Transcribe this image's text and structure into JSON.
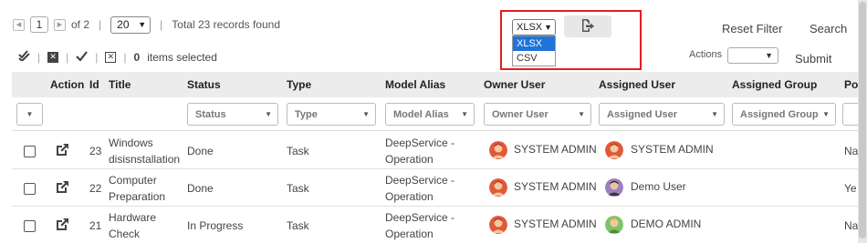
{
  "pager": {
    "current_page": "1",
    "of_label": "of 2",
    "page_size": "20",
    "total_label": "Total 23 records found"
  },
  "selection": {
    "count": "0",
    "label": "items selected"
  },
  "export": {
    "selected_format": "XLSX",
    "options": [
      "XLSX",
      "CSV"
    ]
  },
  "toolbar": {
    "reset_filter": "Reset Filter",
    "search": "Search",
    "actions_label": "Actions",
    "submit": "Submit"
  },
  "table": {
    "columns": [
      "Action",
      "Id",
      "Title",
      "Status",
      "Type",
      "Model Alias",
      "Owner User",
      "Assigned User",
      "Assigned Group",
      "Po"
    ],
    "filters": [
      "Status",
      "Type",
      "Model Alias",
      "Owner User",
      "Assigned User",
      "Assigned Group"
    ],
    "rows": [
      {
        "id": "23",
        "title_1": "Windows",
        "title_2": "disisnstallation",
        "status": "Done",
        "type": "Task",
        "model_1": "DeepService -",
        "model_2": "Operation",
        "owner": "SYSTEM ADMIN",
        "assigned": "SYSTEM ADMIN",
        "po": "Na"
      },
      {
        "id": "22",
        "title_1": "Computer",
        "title_2": "Preparation",
        "status": "Done",
        "type": "Task",
        "model_1": "DeepService -",
        "model_2": "Operation",
        "owner": "SYSTEM ADMIN",
        "assigned": "Demo User",
        "po": "Ye"
      },
      {
        "id": "21",
        "title_1": "Hardware",
        "title_2": "Check",
        "status": "In Progress",
        "type": "Task",
        "model_1": "DeepService -",
        "model_2": "Operation",
        "owner": "SYSTEM ADMIN",
        "assigned": "DEMO ADMIN",
        "po": "Na"
      }
    ]
  },
  "colors": {
    "highlight": "#e02020",
    "dropdown_active": "#1e74d8",
    "header_bg": "#ececec"
  },
  "icons": [
    "first-page-icon",
    "next-page-icon",
    "chevron-down-icon",
    "check-all-icon",
    "deselect-icon",
    "check-icon",
    "clear-selection-icon",
    "export-icon",
    "external-link-icon",
    "avatar-icon"
  ]
}
